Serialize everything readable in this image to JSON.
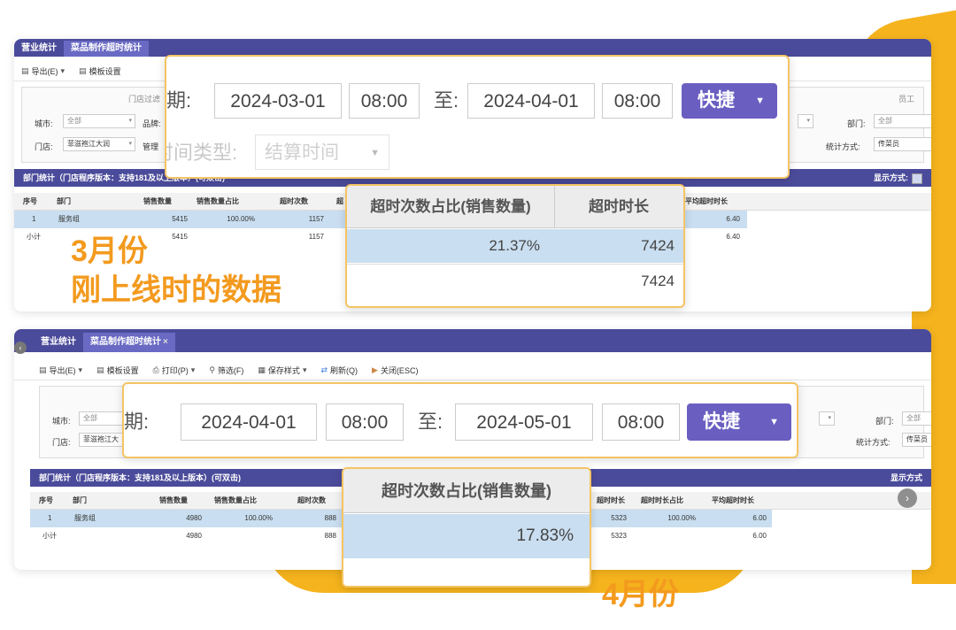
{
  "accent_color": "#f39a1e",
  "header_color": "#4b4b9b",
  "button_color": "#6a5fc1",
  "march": {
    "tabs": [
      "营业统计",
      "菜品制作超时统计"
    ],
    "toolbar": {
      "export": "导出(E)",
      "template": "模板设置"
    },
    "filter": {
      "store_filter": "门店过滤",
      "staff_filter": "员工",
      "city_label": "城市:",
      "city_value": "全部",
      "brand_label": "品牌:",
      "store_label": "门店:",
      "store_value": "菲滋袍江大润",
      "manage_label": "管理",
      "dept_label": "部门:",
      "dept_value": "全部",
      "stat_label": "统计方式:",
      "stat_value": "传菜员"
    },
    "section_title": "部门统计（门店程序版本：支持181及以上版本）(可双击)",
    "display_mode": "显示方式:",
    "grid": {
      "headers": [
        "序号",
        "部门",
        "销售数量",
        "销售数量占比",
        "超时次数",
        "超",
        "平均超时时长"
      ],
      "rows": [
        [
          "1",
          "服务组",
          "5415",
          "100.00%",
          "1157",
          "",
          "6.40"
        ],
        [
          "小计",
          "",
          "5415",
          "",
          "1157",
          "",
          "6.40"
        ]
      ]
    },
    "date_callout": {
      "date_label": "日期:",
      "start_date": "2024-03-01",
      "start_time": "08:00",
      "to_label": "至:",
      "end_date": "2024-04-01",
      "end_time": "08:00",
      "quick_button": "快捷",
      "time_type_label": "时间类型:",
      "time_type_value": "结算时间"
    },
    "table_callout": {
      "headers": [
        "超时次数占比(销售数量)",
        "超时时长"
      ],
      "rows": [
        [
          "21.37%",
          "7424"
        ],
        [
          "",
          "7424"
        ]
      ]
    },
    "caption_line1": "3月份",
    "caption_line2": "刚上线时的数据"
  },
  "april": {
    "tabs": [
      "营业统计",
      "菜品制作超时统计"
    ],
    "tab_close": "×",
    "toolbar": {
      "export": "导出(E)",
      "template": "模板设置",
      "print": "打印(P)",
      "filter": "筛选(F)",
      "save_style": "保存样式",
      "refresh": "刷新(Q)",
      "close": "关闭(ESC)"
    },
    "filter": {
      "city_label": "城市:",
      "city_value": "全部",
      "store_label": "门店:",
      "store_value": "菲滋袍江大",
      "dept_label": "部门:",
      "dept_value": "全部",
      "stat_label": "统计方式:",
      "stat_value": "传菜员"
    },
    "section_title": "部门统计（门店程序版本：支持181及以上版本）(可双击)",
    "display_mode": "显示方式",
    "grid": {
      "headers": [
        "序号",
        "部门",
        "销售数量",
        "销售数量占比",
        "超时次数",
        "超时时长",
        "超时时长占比",
        "平均超时时长"
      ],
      "rows": [
        [
          "1",
          "服务组",
          "4980",
          "100.00%",
          "888",
          "5323",
          "100.00%",
          "6.00"
        ],
        [
          "小计",
          "",
          "4980",
          "",
          "888",
          "5323",
          "",
          "6.00"
        ]
      ]
    },
    "date_callout": {
      "date_label": "日期:",
      "start_date": "2024-04-01",
      "start_time": "08:00",
      "to_label": "至:",
      "end_date": "2024-05-01",
      "end_time": "08:00",
      "quick_button": "快捷"
    },
    "table_callout": {
      "header": "超时次数占比(销售数量)",
      "value": "17.83%"
    },
    "caption": "4月份"
  }
}
